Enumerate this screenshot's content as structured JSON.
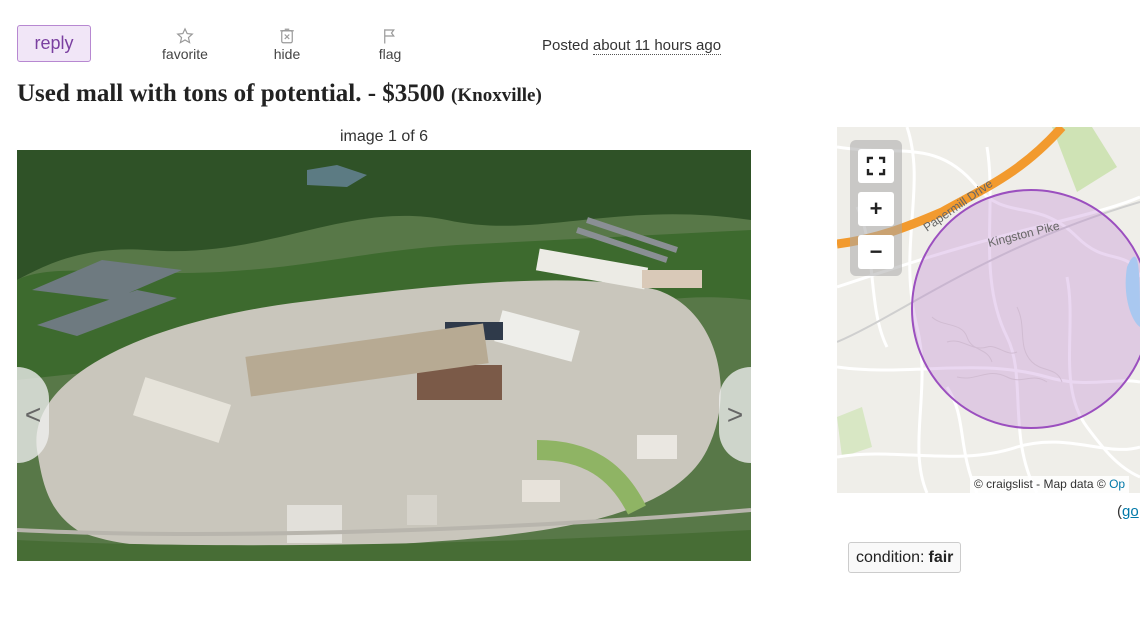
{
  "actions": {
    "reply_label": "reply",
    "favorite_label": "favorite",
    "hide_label": "hide",
    "flag_label": "flag",
    "posted_prefix": "Posted",
    "posted_ago": "about 11 hours ago"
  },
  "listing": {
    "title": "Used mall with tons of potential.",
    "price": "- $3500",
    "location": "(Knoxville)"
  },
  "gallery": {
    "counter": "image 1 of 6",
    "prev_glyph": "<",
    "next_glyph": ">"
  },
  "map": {
    "road_label_1": "Papermill Drive",
    "road_label_2": "Kingston Pike",
    "zoom_in": "+",
    "zoom_out": "−",
    "attribution_prefix": "© craigslist - Map data ©",
    "attribution_osm": "Op",
    "google_paren": "(",
    "google_link": "go"
  },
  "attributes": {
    "condition_label": "condition:",
    "condition_value": "fair"
  },
  "colors": {
    "reply_bg": "#f1e6f7",
    "reply_border": "#b788d1",
    "map_circle": "#9b4fbf",
    "highway": "#f29a2e"
  }
}
